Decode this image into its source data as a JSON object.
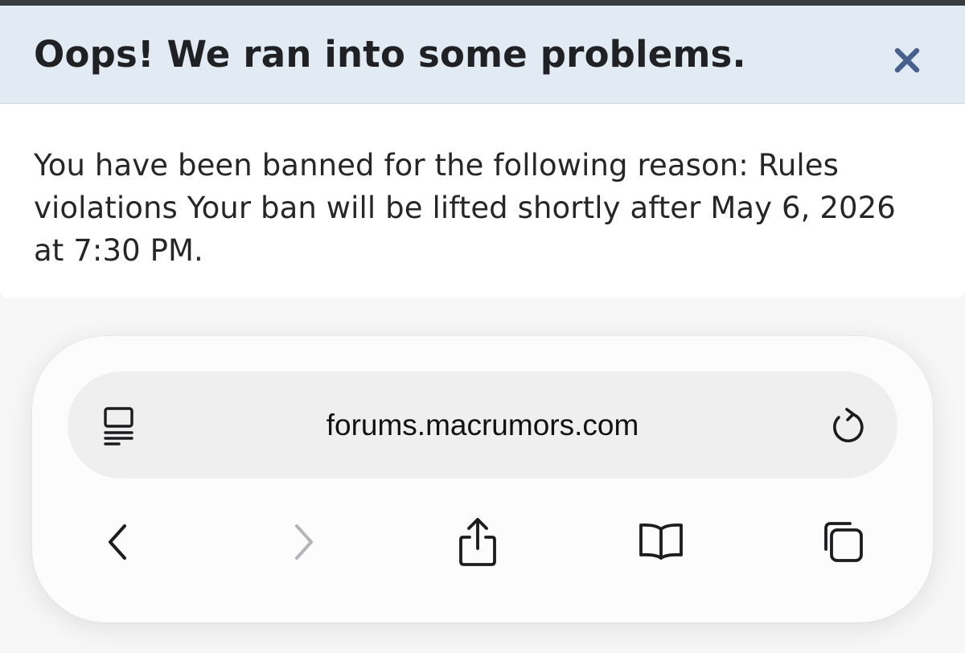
{
  "dialog": {
    "title": "Oops! We ran into some problems.",
    "message": "You have been banned for the following reason: Rules violations Your ban will be lifted shortly after May 6, 2026 at 7:30 PM.",
    "close_icon": "close-icon",
    "header_color": "#e2eaf3",
    "accent_color": "#47618e"
  },
  "browser": {
    "url": "forums.macrumors.com",
    "icons": {
      "reader": "reader-mode-icon",
      "reload": "reload-icon",
      "back": "back-chevron-icon",
      "forward": "forward-chevron-icon",
      "share": "share-icon",
      "bookmarks": "bookmarks-book-icon",
      "tabs": "tabs-icon"
    },
    "forward_enabled": false
  }
}
